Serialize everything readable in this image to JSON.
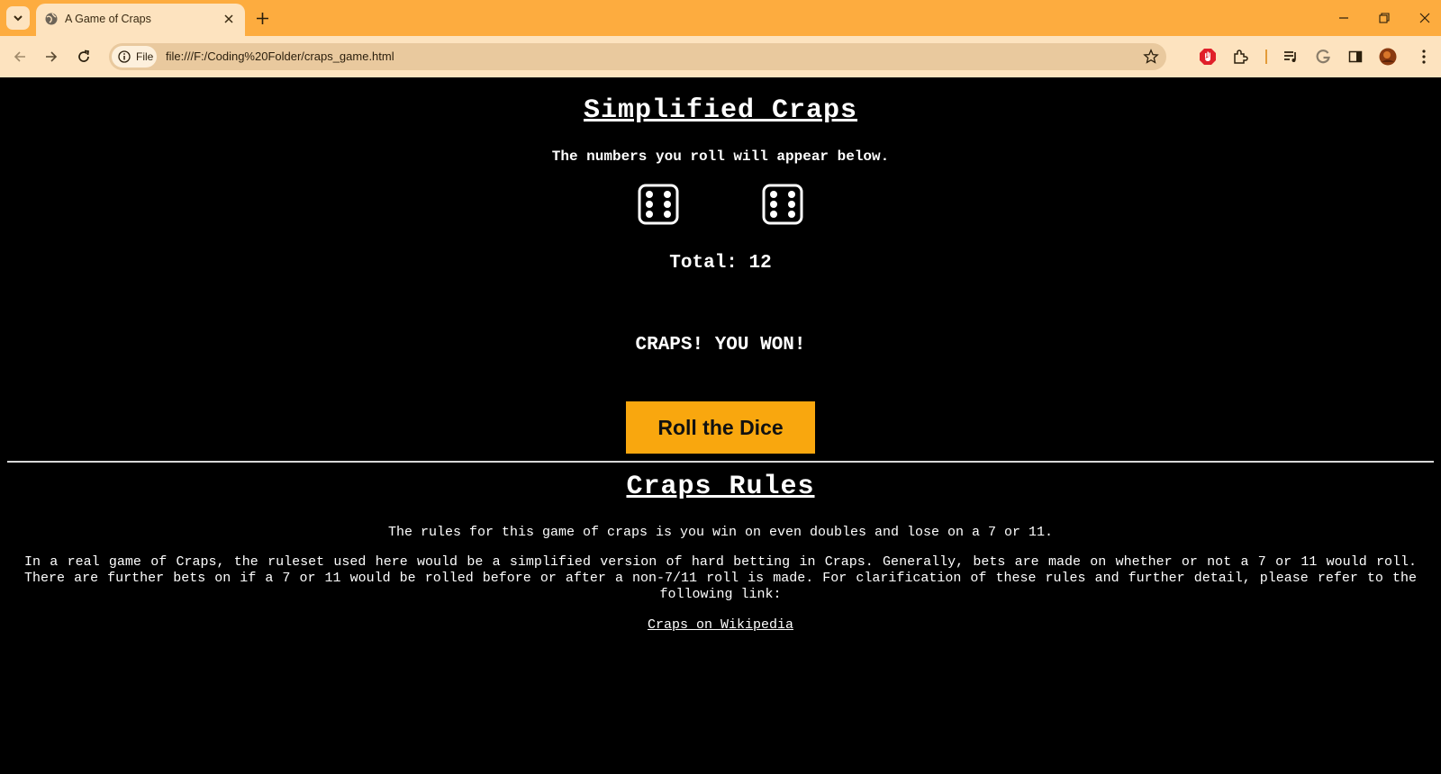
{
  "browser": {
    "tab_title": "A Game of Craps",
    "site_chip": "File",
    "url": "file:///F:/Coding%20Folder/craps_game.html",
    "accent_color": "#fdac3f"
  },
  "game": {
    "title": "Simplified Craps",
    "subtitle": "The numbers you roll will appear below.",
    "dice": [
      6,
      6
    ],
    "total": "Total: 12",
    "result": "CRAPS! YOU WON!",
    "roll_button": "Roll the Dice",
    "button_color": "#f9a70e"
  },
  "rules": {
    "title": "Craps Rules",
    "summary": "The rules for this game of craps is you win on even doubles and lose on a 7 or 11.",
    "detail": "In a real game of Craps, the ruleset used here would be a simplified version of hard betting in Craps. Generally, bets are made on whether or not a 7 or 11 would roll. There are further bets on if a 7 or 11 would be rolled before or after a non-7/11 roll is made. For clarification of these rules and further detail, please refer to the following link:",
    "link_text": "Craps on Wikipedia"
  }
}
